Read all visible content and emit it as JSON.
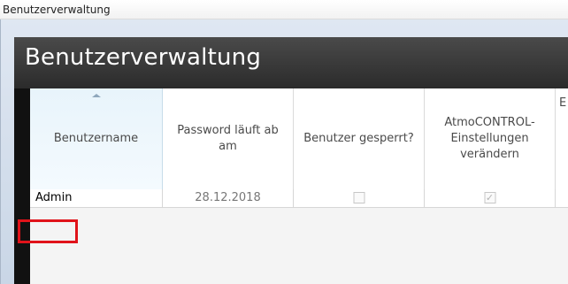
{
  "window": {
    "title": "Benutzerverwaltung"
  },
  "panel": {
    "title": "Benutzerverwaltung"
  },
  "table": {
    "columns": [
      "Benutzername",
      "Password läuft ab am",
      "Benutzer gesperrt?",
      "AtmoCONTROL-Einstellungen verändern",
      "E"
    ],
    "rows": [
      {
        "username": "Admin",
        "expires": "28.12.2018",
        "locked": false,
        "can_change_settings": true
      }
    ]
  },
  "colors": {
    "highlight": "#e0131a",
    "header_bg": "#2b2b2b"
  }
}
